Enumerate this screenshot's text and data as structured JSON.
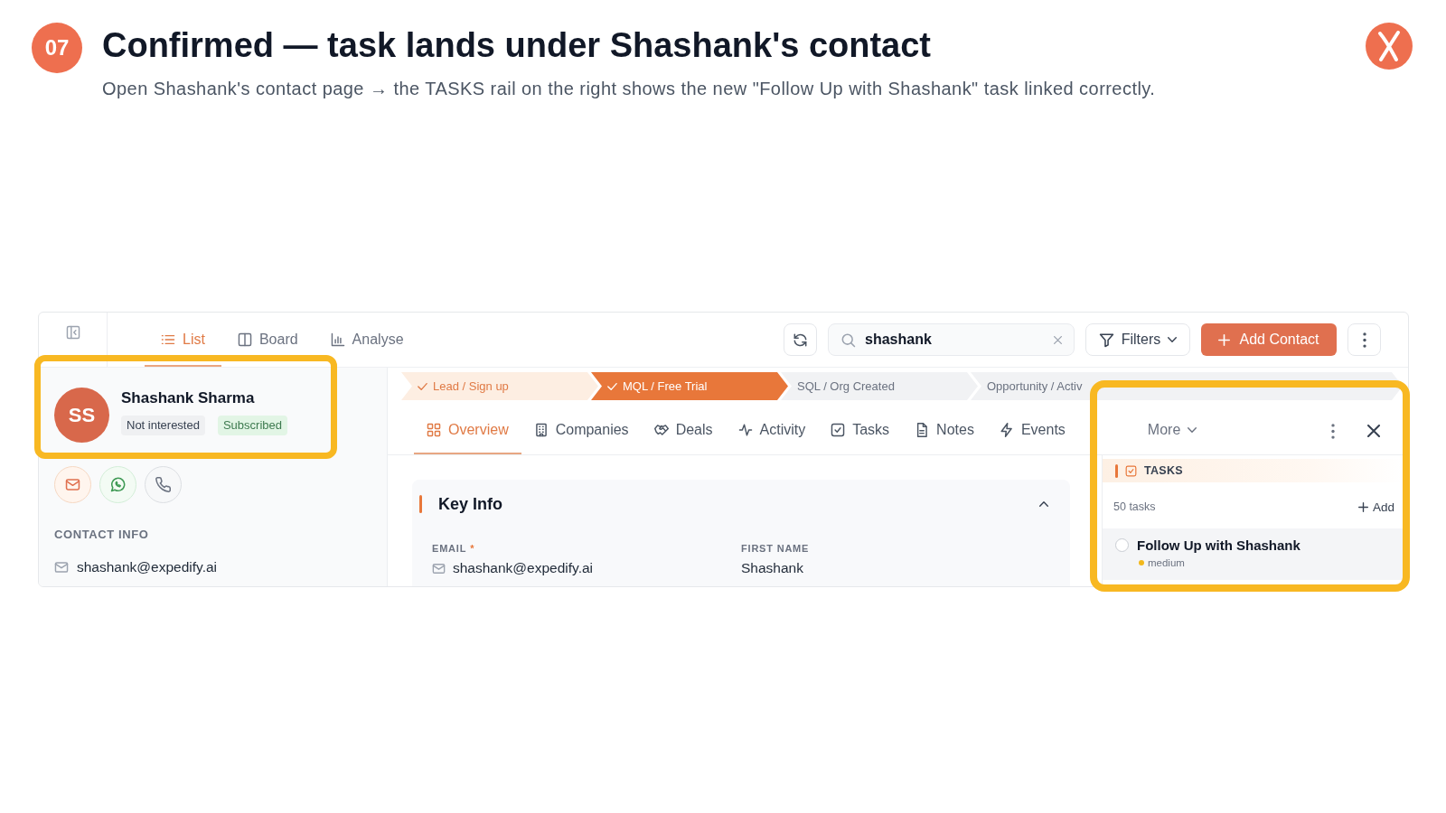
{
  "header": {
    "step": "07",
    "title": "Confirmed — task lands under Shashank's contact",
    "subtitle": "Open Shashank's contact page → the TASKS rail on the right shows the new \"Follow Up with Shashank\" task linked correctly."
  },
  "toolbar": {
    "views": [
      {
        "label": "List",
        "selected": true
      },
      {
        "label": "Board",
        "selected": false
      },
      {
        "label": "Analyse",
        "selected": false
      }
    ],
    "search": {
      "value": "shashank"
    },
    "filters": {
      "label": "Filters"
    },
    "add_button": {
      "label": "Add Contact"
    }
  },
  "contact": {
    "highlighted": true,
    "initials": "SS",
    "name": "Shashank Sharma",
    "tags": [
      {
        "label": "Not interested",
        "kind": "neutral"
      },
      {
        "label": "Subscribed",
        "kind": "success"
      }
    ],
    "actions": [
      {
        "kind": "email"
      },
      {
        "kind": "chat"
      },
      {
        "kind": "phone"
      }
    ],
    "contact_info": {
      "title": "CONTACT INFO",
      "email": "shashank@expedify.ai"
    }
  },
  "pipeline": [
    {
      "label": "Lead / Sign up",
      "completed": true,
      "current": false
    },
    {
      "label": "MQL / Free Trial",
      "completed": true,
      "current": true
    },
    {
      "label": "SQL / Org Created",
      "completed": false,
      "current": false
    },
    {
      "label": "Opportunity / Activ",
      "completed": false,
      "current": false
    }
  ],
  "tabs": [
    {
      "label": "Overview",
      "selected": true
    },
    {
      "label": "Companies",
      "selected": false
    },
    {
      "label": "Deals",
      "selected": false
    },
    {
      "label": "Activity",
      "selected": false
    },
    {
      "label": "Tasks",
      "selected": false
    },
    {
      "label": "Notes",
      "selected": false
    },
    {
      "label": "Events",
      "selected": false
    }
  ],
  "more_menu": {
    "label": "More"
  },
  "key_info": {
    "title": "Key Info",
    "expanded": true,
    "fields": [
      {
        "kind": "email",
        "label": "EMAIL",
        "mark": "*",
        "value": "shashank@expedify.ai"
      },
      {
        "kind": "text",
        "label": "FIRST NAME",
        "value": "Shashank"
      }
    ]
  },
  "tasks_rail": {
    "highlighted": true,
    "title": "TASKS",
    "count": "50 tasks",
    "add_label": "Add",
    "items": [
      {
        "title": "Follow Up with Shashank",
        "done": false,
        "priority": "medium",
        "color": "#f2b81c"
      }
    ]
  }
}
